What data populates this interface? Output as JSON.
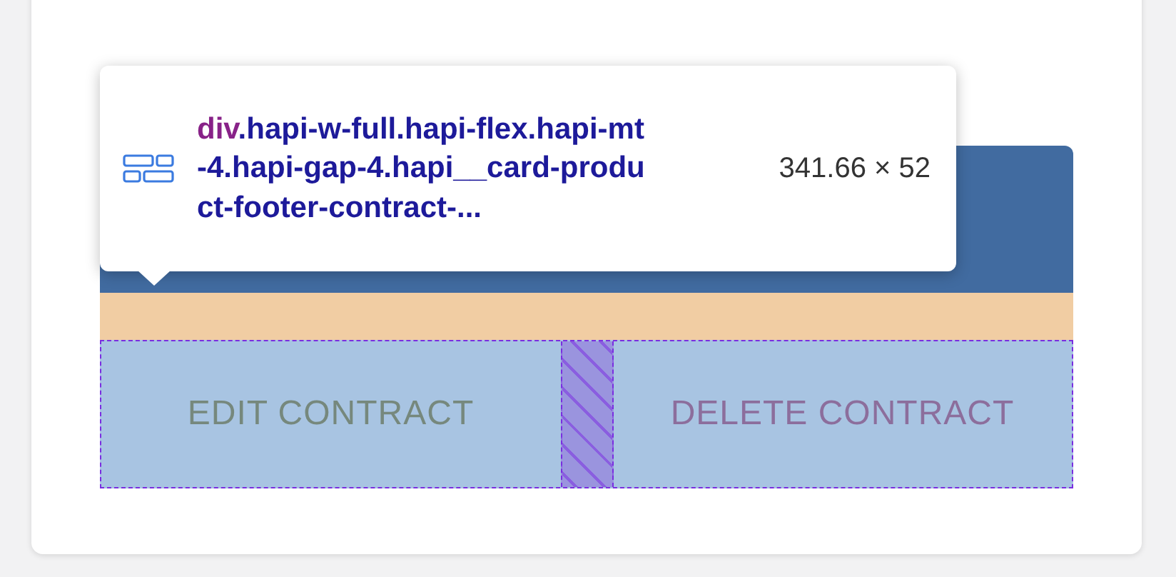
{
  "inspector_tooltip": {
    "tag": "div",
    "selector": ".hapi-w-full.hapi-flex.hapi-mt-4.hapi-gap-4.hapi__card-product-footer-contract-...",
    "size": "341.66 × 52"
  },
  "buttons": [
    {
      "label": "EDIT CONTRACT",
      "disabled": true
    },
    {
      "label": "DELETE CONTRACT",
      "disabled": false
    }
  ]
}
